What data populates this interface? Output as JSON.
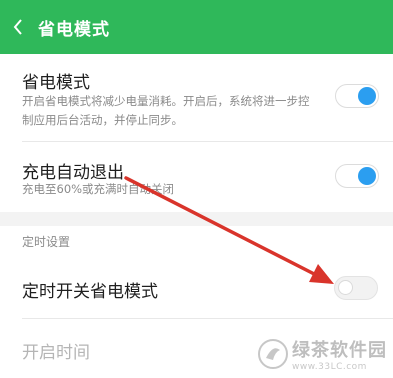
{
  "header": {
    "title": "省电模式",
    "back_icon": "chevron-left-icon"
  },
  "colors": {
    "header_bg": "#2fb85a",
    "toggle_on": "#2b9ef0",
    "arrow": "#d9342b"
  },
  "power_saving": {
    "title": "省电模式",
    "description": "开启省电模式将减少电量消耗。开启后，系统将进一步控制应用后台活动，并停止同步。",
    "enabled": true
  },
  "auto_exit": {
    "title": "充电自动退出",
    "description": "充电至60%或充满时自动关闭",
    "enabled": true
  },
  "schedule_section": {
    "label": "定时设置"
  },
  "scheduled": {
    "title": "定时开关省电模式",
    "enabled": false
  },
  "start_time": {
    "title": "开启时间"
  },
  "watermark": {
    "main": "绿茶软件园",
    "url": "www.33LC.com"
  }
}
